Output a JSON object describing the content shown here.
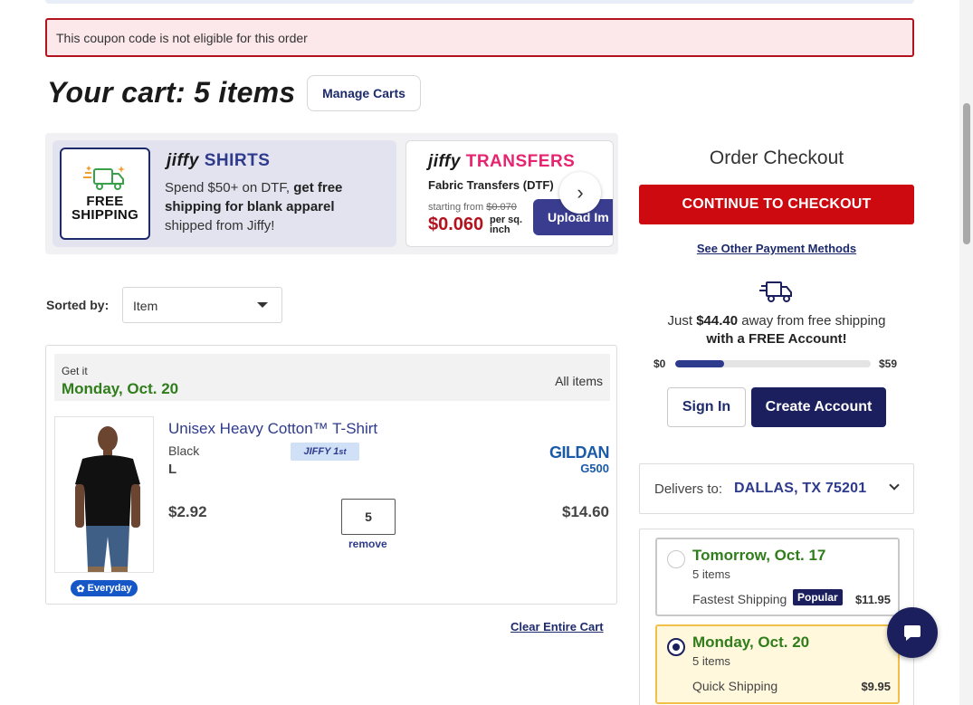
{
  "alert": {
    "message": "This coupon code is not eligible for this order"
  },
  "cart": {
    "title": "Your cart: 5 items",
    "manage_label": "Manage Carts"
  },
  "promo": {
    "shirts": {
      "free_line1": "FREE",
      "free_line2": "SHIPPING",
      "brand_prefix": "jiffy",
      "brand_name": "SHIRTS",
      "text_a": "Spend $50+ on DTF, ",
      "text_b": "get free shipping for blank apparel",
      "text_c": " shipped from Jiffy!"
    },
    "transfers": {
      "brand_prefix": "jiffy",
      "brand_name": "TRANSFERS",
      "subtitle": "Fabric Transfers (DTF)",
      "starting_label": "starting from",
      "old_price": "$0.070",
      "price": "$0.060",
      "per_line1": "per sq.",
      "per_line2": "inch",
      "upload_label": "Upload Im"
    },
    "next_arrow": "›"
  },
  "sort": {
    "label": "Sorted by:",
    "value": "Item"
  },
  "delivery_group": {
    "label": "Get it",
    "date": "Monday, Oct. 20",
    "all_items": "All items"
  },
  "item": {
    "name": "Unisex Heavy Cotton™ T-Shirt",
    "color": "Black",
    "size": "L",
    "jiffy_badge": "JIFFY 1",
    "jiffy_sup": "st",
    "brand": "GILDAN",
    "sku": "G500",
    "unit_price": "$2.92",
    "quantity": "5",
    "remove_label": "remove",
    "total": "$14.60",
    "everyday_label": "Everyday"
  },
  "clear_cart_label": "Clear Entire Cart",
  "checkout": {
    "title": "Order Checkout",
    "continue_label": "CONTINUE TO CHECKOUT",
    "other_pay_label": "See Other Payment Methods",
    "ship_msg_a": "Just ",
    "ship_amount": "$44.40",
    "ship_msg_b": " away from free shipping",
    "ship_msg_c": "with a FREE Account!",
    "progress_min": "$0",
    "progress_max": "$59",
    "progress_fraction": 0.25,
    "signin_label": "Sign In",
    "create_label": "Create Account"
  },
  "deliver_to": {
    "label": "Delivers to:",
    "value": "DALLAS, TX 75201"
  },
  "shipping_options": [
    {
      "date": "Tomorrow, Oct. 17",
      "count": "5 items",
      "speed": "Fastest Shipping",
      "badge": "Popular",
      "price": "$11.95",
      "selected": false
    },
    {
      "date": "Monday, Oct. 20",
      "count": "5 items",
      "speed": "Quick Shipping",
      "price": "$9.95",
      "selected": true
    }
  ],
  "colors": {
    "accent_navy": "#1b1f5e",
    "checkout_red": "#cc0a0f",
    "alert_border": "#b3121f",
    "date_green": "#2f7d1b",
    "link_blue": "#2e3a8c",
    "transfers_pink": "#e6246f"
  },
  "icons": [
    "truck-icon",
    "chevron-right-icon",
    "caret-down-icon",
    "chevron-down-icon",
    "chat-icon",
    "everyday-icon"
  ]
}
